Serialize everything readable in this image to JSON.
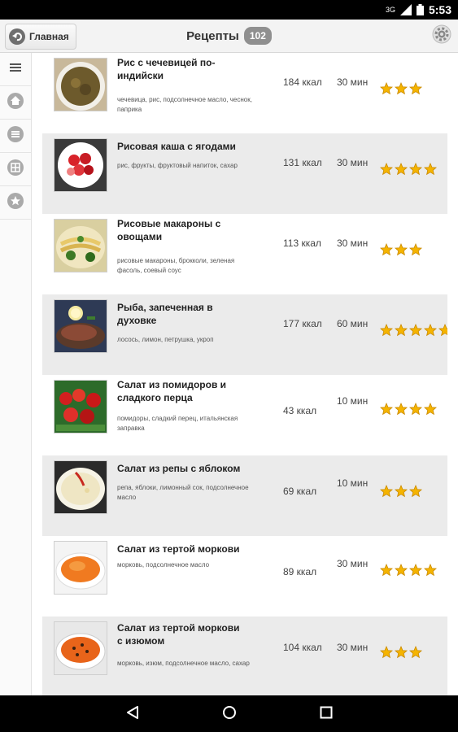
{
  "status_bar": {
    "time": "5:53",
    "network": "3G"
  },
  "header": {
    "home_label": "Главная",
    "title": "Рецепты",
    "count": "102"
  },
  "sidebar": {
    "items": [
      {
        "name": "menu-icon"
      },
      {
        "name": "home-icon"
      },
      {
        "name": "list-icon"
      },
      {
        "name": "grid-icon"
      },
      {
        "name": "star-icon"
      }
    ]
  },
  "recipes": [
    {
      "name": "Рис с чечевицей по-индийски",
      "ingredients": "чечевица, рис, подсолнечное масло, чеснок, паприка",
      "kcal": "184 ккал",
      "time": "30 мин",
      "rating": 3
    },
    {
      "name": "Рисовая каша с ягодами",
      "ingredients": "рис, фрукты, фруктовый напиток, сахар",
      "kcal": "131 ккал",
      "time": "30 мин",
      "rating": 4
    },
    {
      "name": "Рисовые макароны с овощами",
      "ingredients": "рисовые макароны, брокколи, зеленая фасоль, соевый соус",
      "kcal": "113 ккал",
      "time": "30 мин",
      "rating": 3
    },
    {
      "name": "Рыба, запеченная в духовке",
      "ingredients": "лосось, лимон, петрушка, укроп",
      "kcal": "177 ккал",
      "time": "60 мин",
      "rating": 5
    },
    {
      "name": "Салат из помидоров и сладкого перца",
      "ingredients": "помидоры, сладкий перец, итальянская заправка",
      "kcal": "43 ккал",
      "time": "10 мин",
      "rating": 4
    },
    {
      "name": "Салат из репы с яблоком",
      "ingredients": "репа, яблоки, лимонный сок, подсолнечное масло",
      "kcal": "69 ккал",
      "time": "10 мин",
      "rating": 3
    },
    {
      "name": "Салат из тертой моркови",
      "ingredients": "морковь, подсолнечное масло",
      "kcal": "89 ккал",
      "time": "30 мин",
      "rating": 4
    },
    {
      "name": "Салат из тертой моркови с изюмом",
      "ingredients": "морковь, изюм, подсолнечное масло, сахар",
      "kcal": "104 ккал",
      "time": "30 мин",
      "rating": 3
    }
  ],
  "colors": {
    "star": "#f5b400",
    "star_outline": "#c98a00",
    "row_alt": "#ebebeb"
  }
}
